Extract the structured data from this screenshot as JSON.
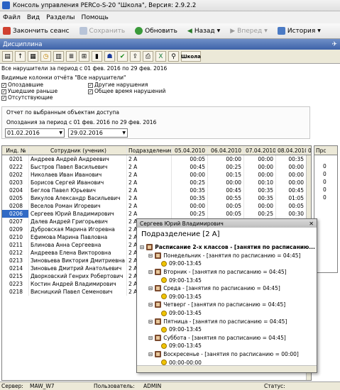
{
  "window": {
    "title": "Консоль управления PERCo-S-20 \"Школа\", Версия: 2.9.2.2"
  },
  "menu": [
    "Файл",
    "Вид",
    "Разделы",
    "Помощь"
  ],
  "toolbar": {
    "end_session": "Закончить сеанс",
    "save": "Сохранить",
    "refresh": "Обновить",
    "back": "Назад",
    "forward": "Вперед",
    "history": "История"
  },
  "section": {
    "title": "Дисциплина"
  },
  "icon_school": "Школа",
  "report": {
    "period_line": "Все нарушители за период с 01 фев. 2016 по 29 фев. 2016",
    "columns_caption": "Видимые колонки отчёта \"Все нарушители\"",
    "checkboxes": [
      {
        "label": "Опоздавшие",
        "checked": true
      },
      {
        "label": "Ушедшие раньше",
        "checked": true
      },
      {
        "label": "Отсутствующие",
        "checked": true
      },
      {
        "label": "Другие нарушения",
        "checked": true
      },
      {
        "label": "Общее время нарушений",
        "checked": true
      }
    ],
    "filter_caption": "Отчет по выбранным объектам доступа",
    "lateness_line": "Опоздания за период с 01 фев. 2016 по 29 фев. 2016",
    "date_from": "01.02.2016",
    "date_to": "29.02.2016"
  },
  "table": {
    "headers": [
      "Инд. №",
      "Сотрудник (ученик)",
      "Подразделение",
      "05.04.2010",
      "06.04.2010",
      "07.04.2010",
      "08.04.2010",
      "0"
    ],
    "rows": [
      [
        "0201",
        "Андреев Андрей Андреевич",
        "2 А",
        "00:05",
        "00:00",
        "00:00",
        "00:35"
      ],
      [
        "0222",
        "Быстров Павел Васильевич",
        "2 А",
        "00:45",
        "00:25",
        "00:00",
        "00:00"
      ],
      [
        "0202",
        "Николаев Иван Иванович",
        "2 А",
        "00:00",
        "00:15",
        "00:00",
        "00:00"
      ],
      [
        "0203",
        "Борисов Сергей Иванович",
        "2 А",
        "00:25",
        "00:00",
        "00:10",
        "00:00"
      ],
      [
        "0204",
        "Беглов Павел Юрьевич",
        "2 А",
        "00:35",
        "00:45",
        "00:35",
        "00:45"
      ],
      [
        "0205",
        "Викулов Александр Васильевич",
        "2 А",
        "00:35",
        "00:55",
        "00:35",
        "01:05"
      ],
      [
        "0208",
        "Веселов Роман Игоревич",
        "2 А",
        "00:00",
        "00:05",
        "00:00",
        "00:05"
      ],
      [
        "0206",
        "Сергеев Юрий Владимирович",
        "2 А",
        "00:25",
        "00:05",
        "00:25",
        "00:30"
      ],
      [
        "0207",
        "Далев Андрей Григорьевич",
        "2 А",
        "",
        "",
        "",
        ""
      ],
      [
        "0209",
        "Дубровская Марина Игоревна",
        "2 А",
        "",
        "",
        "",
        ""
      ],
      [
        "0210",
        "Ефимова Марина Павловна",
        "2 А",
        "",
        "",
        "",
        ""
      ],
      [
        "0211",
        "Блинова Анна Сергеевна",
        "2 А",
        "",
        "",
        "",
        ""
      ],
      [
        "0212",
        "Андреева Елена Викторовна",
        "2 А",
        "",
        "",
        "",
        ""
      ],
      [
        "0213",
        "Зиновьева Виктория Дмитриевна",
        "2 А",
        "",
        "",
        "",
        ""
      ],
      [
        "0214",
        "Зиновьев Дмитрий Анатольевич",
        "2 А",
        "",
        "",
        "",
        ""
      ],
      [
        "0215",
        "Дворковский Генрих Робертович",
        "2 А",
        "",
        "",
        "",
        ""
      ],
      [
        "0223",
        "Костин Андрей Владимирович",
        "2 А",
        "",
        "",
        "",
        ""
      ],
      [
        "0218",
        "Висницкий Павел Семенович",
        "2 А",
        "",
        "",
        "",
        ""
      ]
    ]
  },
  "rightpane": {
    "header": "Прс",
    "values": [
      "0",
      "0",
      "0",
      "0",
      "0"
    ]
  },
  "popup": {
    "caption": "Сергеев Юрий Владимирович",
    "dept": "Подразделение [2 А]",
    "schedule": "Расписание 2-х классов - [занятия по расписанию...",
    "days": [
      {
        "label": "Понедельник - [занятия по расписанию = 04:45]",
        "time": "09:00-13:45"
      },
      {
        "label": "Вторник - [занятия по расписанию = 04:45]",
        "time": "09:00-13:45"
      },
      {
        "label": "Среда - [занятия по расписанию = 04:45]",
        "time": "09:00-13:45"
      },
      {
        "label": "Четверг - [занятия по расписанию = 04:45]",
        "time": "09:00-13:45"
      },
      {
        "label": "Пятница - [занятия по расписанию = 04:45]",
        "time": "09:00-13:45"
      },
      {
        "label": "Суббота - [занятия по расписанию = 04:45]",
        "time": "09:00-13:45"
      },
      {
        "label": "Воскресенье - [занятия по расписанию = 00:00]",
        "time": "00:00-00:00"
      }
    ]
  },
  "status": {
    "server_label": "Сервер:",
    "server": "MAW_W7",
    "user_label": "Пользователь:",
    "user": "ADMIN",
    "status_label": "Статус:"
  }
}
